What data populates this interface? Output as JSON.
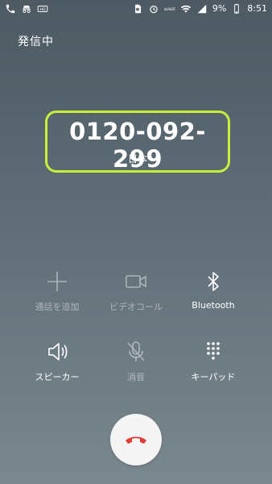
{
  "status_bar": {
    "left_icons": [
      "phone-icon",
      "incognito-icon",
      "hd-icon"
    ],
    "right_icons": [
      "sd-card-icon",
      "alarm-icon",
      "vowifi-icon",
      "wifi-icon",
      "signal-icon"
    ],
    "battery": "9%",
    "time": "8:51"
  },
  "call": {
    "status": "発信中",
    "number": "0120-092-299",
    "country": "日本"
  },
  "buttons": {
    "add_call": "通話を追加",
    "video_call": "ビデオコール",
    "bluetooth": "Bluetooth",
    "speaker": "スピーカー",
    "mute": "消音",
    "keypad": "キーパッド"
  },
  "colors": {
    "highlight": "#c8f03a",
    "end_call_icon": "#e53935"
  }
}
